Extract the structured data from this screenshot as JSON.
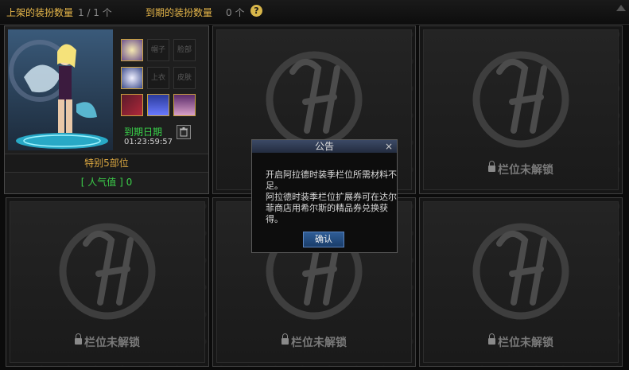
{
  "header": {
    "listed_label": "上架的装扮数量",
    "listed_value": "1 / 1 个",
    "expired_label": "到期的装扮数量",
    "expired_value": "0 个",
    "help_glyph": "?"
  },
  "slot1": {
    "equip_slots": [
      "帽子",
      "脸部",
      "上衣",
      "皮肤"
    ],
    "expire_label": "到期日期",
    "expire_time": "01:23:59:57",
    "name": "特别5部位",
    "popularity": "[ 人气值 ] 0"
  },
  "locked_label": "栏位未解锁",
  "dialog": {
    "title": "公告",
    "close": "×",
    "line1": "开启阿拉德时装季栏位所需材料不足。",
    "line2": "阿拉德时装季栏位扩展券可在达尔菲商店用希尔斯的精品券兑换获得。",
    "ok": "确认"
  },
  "colors": {
    "accent": "#e8b84a",
    "green": "#39d04a",
    "button": "#2f5d96"
  }
}
